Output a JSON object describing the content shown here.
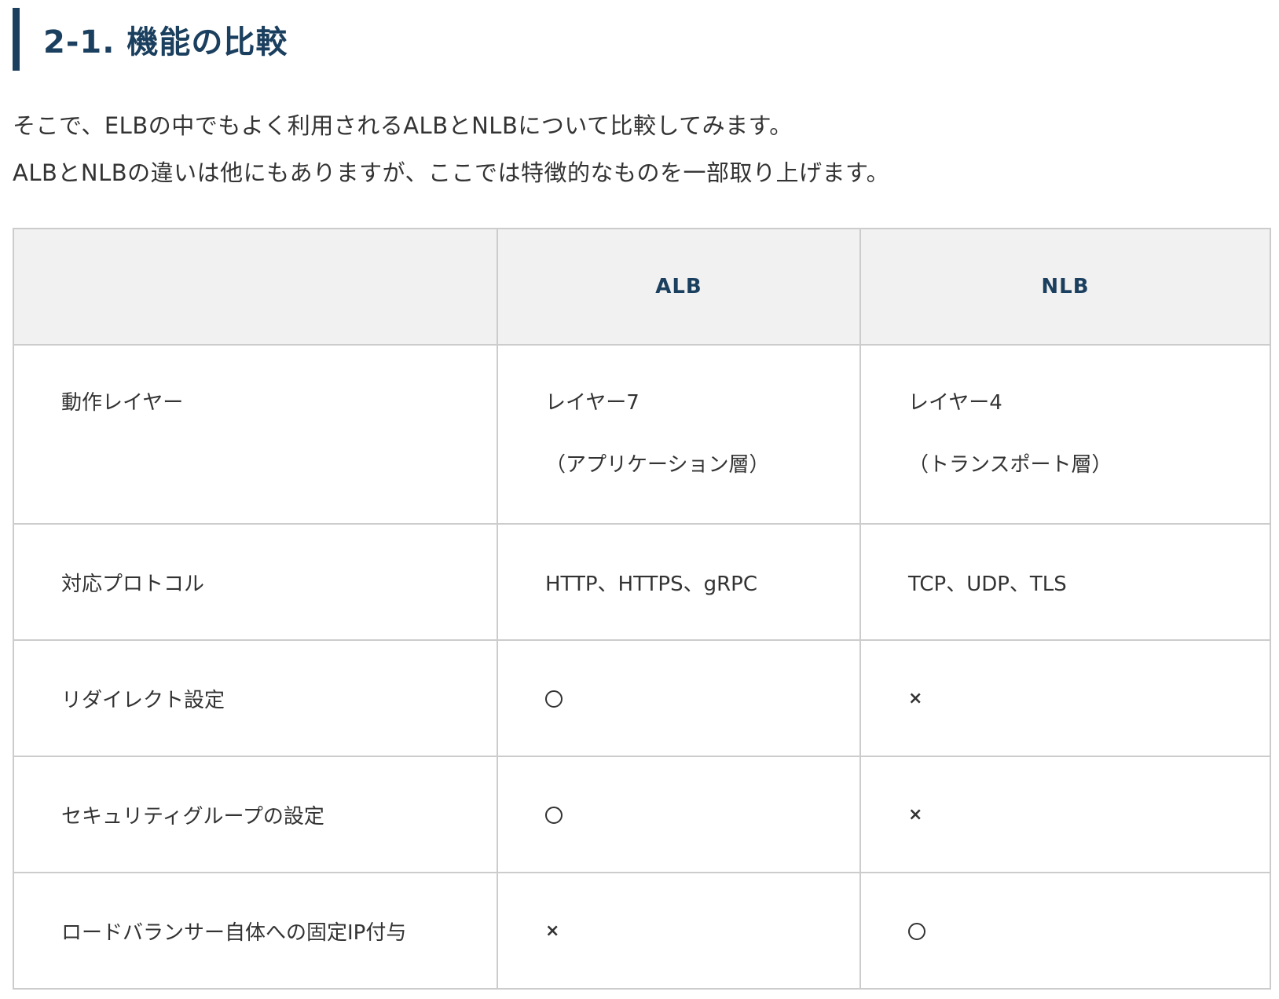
{
  "heading": "2-1. 機能の比較",
  "intro": [
    "そこで、ELBの中でもよく利用されるALBとNLBについて比較してみます。",
    "ALBとNLBの違いは他にもありますが、ここでは特徴的なものを一部取り上げます。"
  ],
  "table": {
    "headers": [
      "",
      "ALB",
      "NLB"
    ],
    "rows": [
      {
        "label": "動作レイヤー",
        "alb": [
          "レイヤー7",
          "（アプリケーション層）"
        ],
        "nlb": [
          "レイヤー4",
          "（トランスポート層）"
        ]
      },
      {
        "label": "対応プロトコル",
        "alb": "HTTP、HTTPS、gRPC",
        "nlb": "TCP、UDP、TLS"
      },
      {
        "label": "リダイレクト設定",
        "alb": "〇",
        "nlb": "×"
      },
      {
        "label": "セキュリティグループの設定",
        "alb": "〇",
        "nlb": "×"
      },
      {
        "label": "ロードバランサー自体への固定IP付与",
        "alb": "×",
        "nlb": "〇"
      }
    ]
  },
  "icons": {
    "supported": "circle-icon",
    "unsupported": "cross-icon"
  },
  "colors": {
    "accent": "#1b3f5e",
    "header_bg": "#f1f1f1",
    "border": "#cccccc",
    "text": "#333333"
  }
}
